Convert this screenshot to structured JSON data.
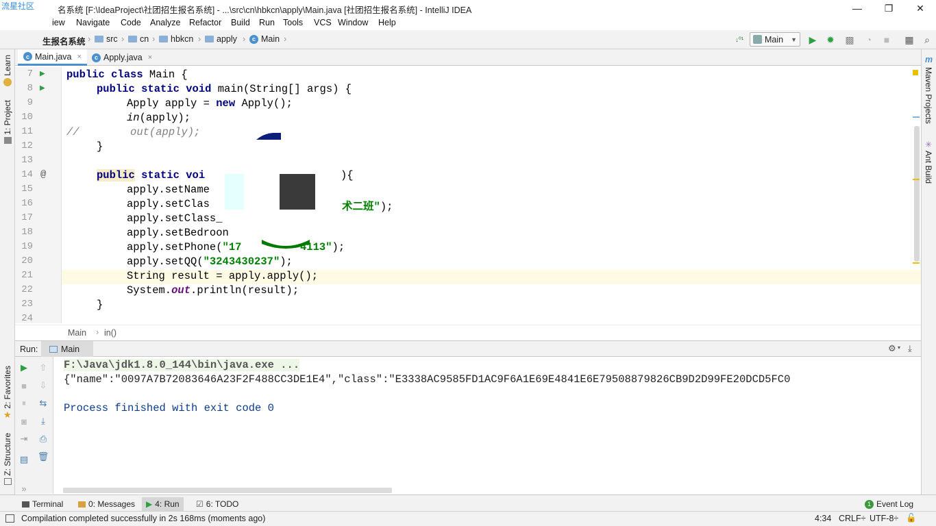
{
  "watermark": "流星社区",
  "window": {
    "title": "名系统 [F:\\IdeaProject\\社团招生报名系统] - ...\\src\\cn\\hbkcn\\apply\\Main.java [社团招生报名系统] - IntelliJ IDEA",
    "minimize": "—",
    "restore": "❐",
    "close": "✕"
  },
  "menu": [
    "iew",
    "Navigate",
    "Code",
    "Analyze",
    "Refactor",
    "Build",
    "Run",
    "Tools",
    "VCS",
    "Window",
    "Help"
  ],
  "nav": {
    "project": "生报名系统",
    "crumbs": [
      "src",
      "cn",
      "hbkcn",
      "apply",
      "Main"
    ],
    "run_config": "Main"
  },
  "left_strip": {
    "learn": "Learn",
    "project": "1: Project",
    "favorites": "2: Favorites",
    "structure": "Z: Structure"
  },
  "right_strip": {
    "maven": "Maven Projects",
    "ant": "Ant Build"
  },
  "tabs": [
    {
      "label": "Main.java",
      "close": "×"
    },
    {
      "label": "Apply.java",
      "close": "×"
    }
  ],
  "code": {
    "line_numbers": [
      "7",
      "8",
      "9",
      "10",
      "11",
      "12",
      "13",
      "14",
      "15",
      "16",
      "17",
      "18",
      "19",
      "20",
      "21",
      "22",
      "23",
      "24"
    ],
    "l7": {
      "kw": "public class ",
      "txt": "Main {"
    },
    "l8": {
      "kw": "public static void ",
      "txt": "main(String[] args) {"
    },
    "l9": {
      "a": "Apply apply = ",
      "kw": "new ",
      "b": "Apply();"
    },
    "l10": {
      "it": "in",
      "b": "(apply);"
    },
    "l11": {
      "c": "//        out(apply);"
    },
    "l12": "}",
    "l14": {
      "kw1": "public",
      "kw2": " static voi",
      "tail": "){"
    },
    "l15": "apply.setName",
    "l16": {
      "a": "apply.setClas",
      "s": "术二班\"",
      "b": ");"
    },
    "l17": "apply.setClass_",
    "l18": "apply.setBedroon",
    "l19": {
      "a": "apply.setPhone(",
      "s": "\"17",
      "s2": "4113\"",
      "b": ");"
    },
    "l20": {
      "a": "apply.setQQ(",
      "s": "\"3243430237\"",
      "b": ");"
    },
    "l21": "String result = apply.apply();",
    "l22": {
      "a": "System.",
      "f": "out",
      "b": ".println(result);"
    },
    "l23": "}",
    "gutter_at": "@"
  },
  "editor_crumb": [
    "Main",
    "in()"
  ],
  "run_panel": {
    "label": "Run:",
    "tab": "Main",
    "lines": [
      "F:\\Java\\jdk1.8.0_144\\bin\\java.exe ...",
      "{\"name\":\"0097A7B72083646A23F2F488CC3DE1E4\",\"class\":\"E3338AC9585FD1AC9F6A1E69E4841E6E79508879826CB9D2D99FE20DCD5FC0",
      "",
      "Process finished with exit code 0"
    ]
  },
  "tool_tabs": [
    {
      "label": "Terminal"
    },
    {
      "label": "0: Messages"
    },
    {
      "label": "4: Run"
    },
    {
      "label": "6: TODO"
    },
    {
      "label": "Event Log",
      "badge": "1"
    }
  ],
  "status": {
    "message": "Compilation completed successfully in 2s 168ms (moments ago)",
    "position": "4:34",
    "line_sep": "CRLF÷",
    "encoding": "UTF-8÷"
  },
  "colors": {
    "keyword": "#000080",
    "string": "#008000",
    "accent": "#4a8fcf",
    "run_green": "#2ea043"
  }
}
